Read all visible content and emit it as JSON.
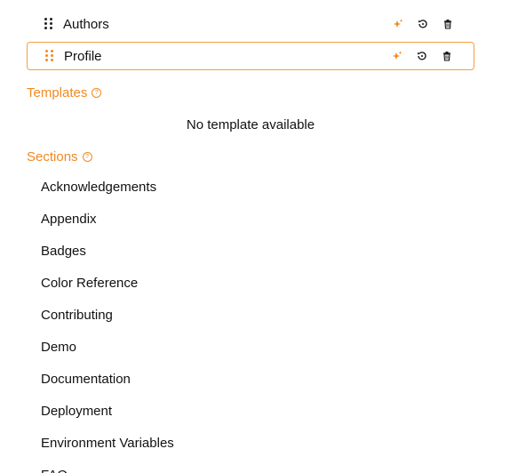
{
  "selected_sections": [
    {
      "label": "Authors",
      "active": false
    },
    {
      "label": "Profile",
      "active": true
    }
  ],
  "templates": {
    "heading": "Templates",
    "empty_text": "No template available"
  },
  "sections": {
    "heading": "Sections",
    "items": [
      "Acknowledgements",
      "Appendix",
      "Badges",
      "Color Reference",
      "Contributing",
      "Demo",
      "Documentation",
      "Deployment",
      "Environment Variables",
      "FAQ"
    ]
  },
  "colors": {
    "accent": "#f08a24",
    "active_border": "#f0a040",
    "text": "#111111"
  },
  "icons": {
    "drag": "drag-handle-icon",
    "magic": "sparkle-icon",
    "reset": "reset-icon",
    "delete": "trash-icon",
    "help": "help-circle-icon"
  }
}
